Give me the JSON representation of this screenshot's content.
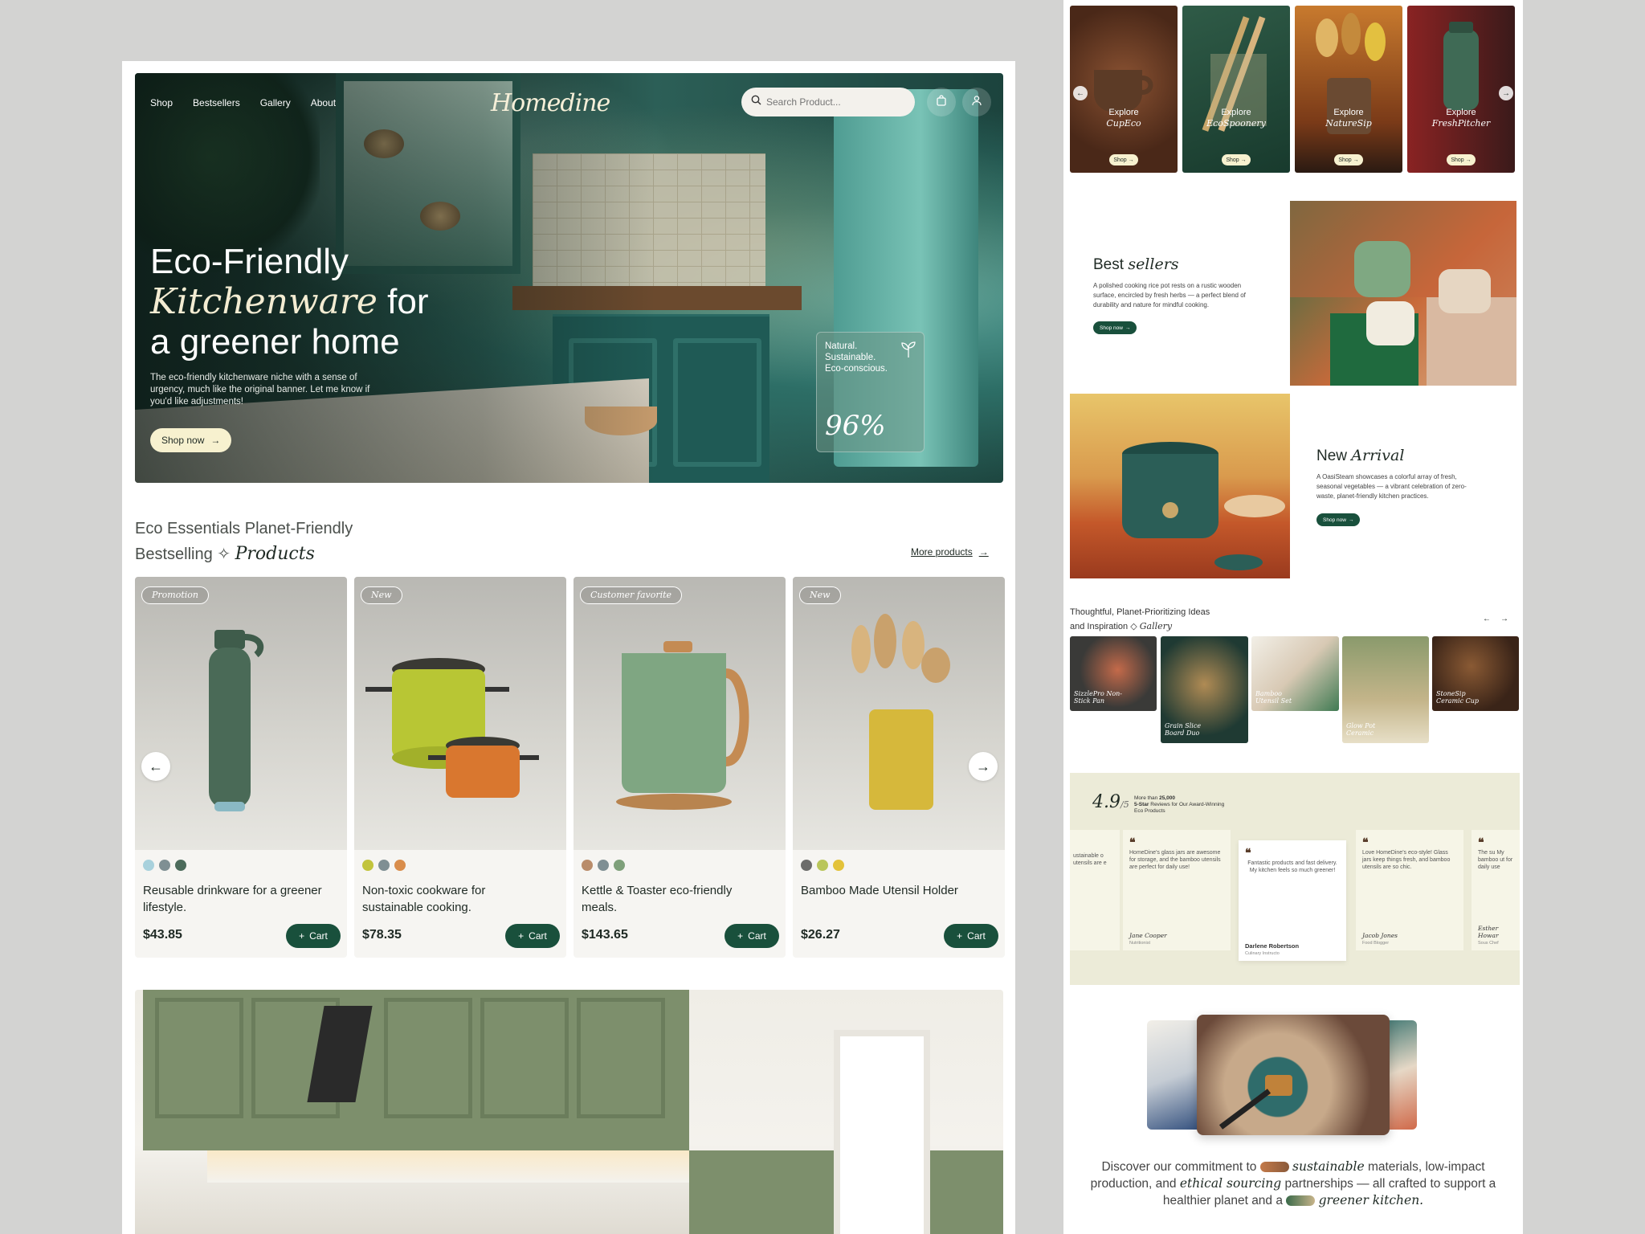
{
  "colors": {
    "brand_green": "#19503c",
    "cream": "#f7f1cf",
    "background": "#d3d3d2"
  },
  "header": {
    "nav": [
      "Shop",
      "Bestsellers",
      "Gallery",
      "About"
    ],
    "logo": "Homedine",
    "search_placeholder": "Search Product...",
    "icons": [
      "search-icon",
      "bag-icon",
      "user-icon"
    ]
  },
  "hero": {
    "title_line1": "Eco-Friendly",
    "title_italic": "Kitchenware",
    "title_line2_rest": " for",
    "title_line3": "a greener home",
    "subtitle": "The eco-friendly kitchenware niche with a sense of urgency, much like the original banner. Let me know if you'd like adjustments!",
    "cta": "Shop now",
    "stat_text": "Natural. Sustainable. Eco-conscious.",
    "stat_value": "96%"
  },
  "bestselling": {
    "title_line1": "Eco Essentials Planet-Friendly",
    "title_line2_plain": "Bestselling ✧",
    "title_line2_italic": "Products",
    "more": "More products",
    "cart_label": "Cart",
    "products": [
      {
        "tag": "Promotion",
        "name": "Reusable drinkware for a greener lifestyle.",
        "price": "$43.85",
        "swatches": [
          "#a8d1dc",
          "#7f8f93",
          "#4c6b5b"
        ]
      },
      {
        "tag": "New",
        "name": "Non-toxic cookware for sustainable cooking.",
        "price": "$78.35",
        "swatches": [
          "#c2c43c",
          "#7f8f93",
          "#d98d4b"
        ]
      },
      {
        "tag": "Customer favorite",
        "name": "Kettle & Toaster eco-friendly meals.",
        "price": "$143.65",
        "swatches": [
          "#b98c6a",
          "#7f8f93",
          "#7ea07a"
        ]
      },
      {
        "tag": "New",
        "name": "Bamboo Made Utensil Holder",
        "price": "$26.27",
        "swatches": [
          "#6c6c6a",
          "#b9c65a",
          "#e3c23a"
        ]
      }
    ]
  },
  "explore": [
    {
      "label": "Explore",
      "name": "CupEco",
      "button": "Shop"
    },
    {
      "label": "Explore",
      "name": "EcoSpoonery",
      "button": "Shop"
    },
    {
      "label": "Explore",
      "name": "NatureSip",
      "button": "Shop"
    },
    {
      "label": "Explore",
      "name": "FreshPitcher",
      "button": "Shop"
    }
  ],
  "best_sellers": {
    "title_plain": "Best",
    "title_italic": "sellers",
    "desc": "A polished cooking rice pot rests on a rustic wooden surface, encircled by fresh herbs — a perfect blend of durability and nature for mindful cooking.",
    "button": "Shop now"
  },
  "new_arrival": {
    "title_plain": "New",
    "title_italic": "Arrival",
    "desc": "A OasiSteam showcases a colorful array of fresh, seasonal vegetables — a vibrant celebration of zero-waste, planet-friendly kitchen practices.",
    "button": "Shop now"
  },
  "gallery": {
    "title_line1": "Thoughtful, Planet-Prioritizing Ideas",
    "title_line2_plain": "and Inspiration ◇",
    "title_line2_italic": "Gallery",
    "items": [
      "SizzlePro Non-Stick Pan",
      "Grain Slice Board Duo",
      "Bamboo Utensil Set",
      "Glow Pot Ceramic",
      "StoneSip Ceramic Cup"
    ]
  },
  "reviews": {
    "rating": "4.9",
    "rating_of": "/5",
    "summary_pre": "More than ",
    "summary_count": "25,000",
    "summary_bold": "5-Star",
    "summary_rest": " Reviews for Our Award-Winning Eco Products",
    "items": [
      {
        "text": "ustainable o utensils are e",
        "name": "",
        "role": ""
      },
      {
        "text": "HomeDine's glass jars are awesome for storage, and the bamboo utensils are perfect for daily use!",
        "name": "Jane Cooper",
        "role": "Nutritionist"
      },
      {
        "text": "Fantastic products and fast delivery. My kitchen feels so much greener!",
        "name": "Darlene Robertson",
        "role": "Culinary Instructo"
      },
      {
        "text": "Love HomeDine's eco-style! Glass jars keep things fresh, and bamboo utensils are so chic.",
        "name": "Jacob Jones",
        "role": "Food Blogger"
      },
      {
        "text": "The su My bamboo ut for daily use",
        "name": "Esther Howar",
        "role": "Sous Chef"
      }
    ]
  },
  "commitment": {
    "p1": "Discover our commitment to ",
    "it1": "sustainable",
    "p2": " materials, low-impact production, and ",
    "it2": "ethical sourcing",
    "p3": " partnerships — all crafted to support a healthier planet and a ",
    "it3": "greener kitchen."
  }
}
